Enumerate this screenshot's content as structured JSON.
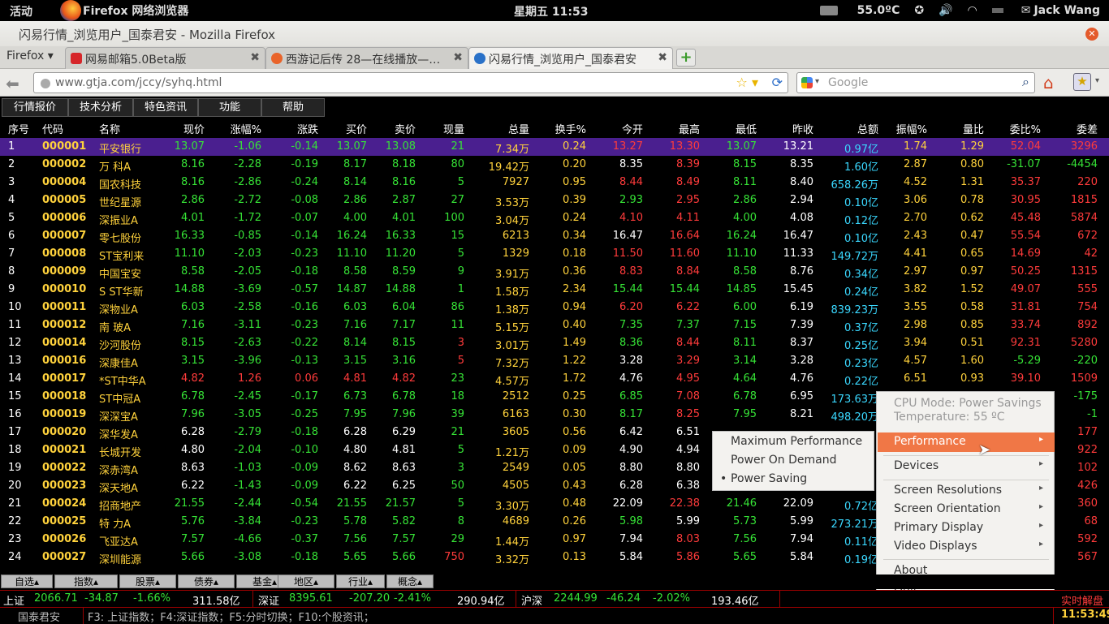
{
  "topbar": {
    "activities": "活动",
    "app": "Firefox 网络浏览器",
    "clock": "星期五 11:53",
    "temp": "55.0ºC",
    "user": "Jack Wang"
  },
  "window": {
    "title": "闪易行情_浏览用户_国泰君安 - Mozilla Firefox"
  },
  "tabs": {
    "menu": "Firefox",
    "items": [
      {
        "label": "网易邮箱5.0Beta版",
        "color": "#d6262a"
      },
      {
        "label": "西游记后传 28—在线播放—…",
        "color": "#e9642a"
      },
      {
        "label": "闪易行情_浏览用户_国泰君安",
        "color": "#2a71c8"
      }
    ]
  },
  "nav": {
    "url": "www.gtja.com/jccy/syhq.html",
    "search_placeholder": "Google"
  },
  "menu": [
    "行情报价",
    "技术分析",
    "特色资讯",
    "功能",
    "帮助"
  ],
  "headers": [
    "序号",
    "代码",
    "名称",
    "现价",
    "涨幅%",
    "涨跌",
    "买价",
    "卖价",
    "现量",
    "总量",
    "换手%",
    "今开",
    "最高",
    "最低",
    "昨收",
    "总额",
    "振幅%",
    "量比",
    "委比%",
    "委差"
  ],
  "rows": [
    [
      "1",
      "000001",
      "平安银行",
      "13.07",
      "-1.06",
      "-0.14",
      "13.07",
      "13.08",
      "21",
      "7.34万",
      "0.24",
      "13.27",
      "13.30",
      "13.07",
      "13.21",
      "0.97亿",
      "1.74",
      "1.29",
      "52.04",
      "3296"
    ],
    [
      "2",
      "000002",
      "万  科A",
      "8.16",
      "-2.28",
      "-0.19",
      "8.17",
      "8.18",
      "80",
      "19.42万",
      "0.20",
      "8.35",
      "8.39",
      "8.15",
      "8.35",
      "1.60亿",
      "2.87",
      "0.80",
      "-31.07",
      "-4454"
    ],
    [
      "3",
      "000004",
      "国农科技",
      "8.16",
      "-2.86",
      "-0.24",
      "8.14",
      "8.16",
      "5",
      "7927",
      "0.95",
      "8.44",
      "8.49",
      "8.11",
      "8.40",
      "658.26万",
      "4.52",
      "1.31",
      "35.37",
      "220"
    ],
    [
      "4",
      "000005",
      "世纪星源",
      "2.86",
      "-2.72",
      "-0.08",
      "2.86",
      "2.87",
      "27",
      "3.53万",
      "0.39",
      "2.93",
      "2.95",
      "2.86",
      "2.94",
      "0.10亿",
      "3.06",
      "0.78",
      "30.95",
      "1815"
    ],
    [
      "5",
      "000006",
      "深振业A",
      "4.01",
      "-1.72",
      "-0.07",
      "4.00",
      "4.01",
      "100",
      "3.04万",
      "0.24",
      "4.10",
      "4.11",
      "4.00",
      "4.08",
      "0.12亿",
      "2.70",
      "0.62",
      "45.48",
      "5874"
    ],
    [
      "6",
      "000007",
      "零七股份",
      "16.33",
      "-0.85",
      "-0.14",
      "16.24",
      "16.33",
      "15",
      "6213",
      "0.34",
      "16.47",
      "16.64",
      "16.24",
      "16.47",
      "0.10亿",
      "2.43",
      "0.47",
      "55.54",
      "672"
    ],
    [
      "7",
      "000008",
      "ST宝利来",
      "11.10",
      "-2.03",
      "-0.23",
      "11.10",
      "11.20",
      "5",
      "1329",
      "0.18",
      "11.50",
      "11.60",
      "11.10",
      "11.33",
      "149.72万",
      "4.41",
      "0.65",
      "14.69",
      "42"
    ],
    [
      "8",
      "000009",
      "中国宝安",
      "8.58",
      "-2.05",
      "-0.18",
      "8.58",
      "8.59",
      "9",
      "3.91万",
      "0.36",
      "8.83",
      "8.84",
      "8.58",
      "8.76",
      "0.34亿",
      "2.97",
      "0.97",
      "50.25",
      "1315"
    ],
    [
      "9",
      "000010",
      "S ST华新",
      "14.88",
      "-3.69",
      "-0.57",
      "14.87",
      "14.88",
      "1",
      "1.58万",
      "2.34",
      "15.44",
      "15.44",
      "14.85",
      "15.45",
      "0.24亿",
      "3.82",
      "1.52",
      "49.07",
      "555"
    ],
    [
      "10",
      "000011",
      "深物业A",
      "6.03",
      "-2.58",
      "-0.16",
      "6.03",
      "6.04",
      "86",
      "1.38万",
      "0.94",
      "6.20",
      "6.22",
      "6.00",
      "6.19",
      "839.23万",
      "3.55",
      "0.58",
      "31.81",
      "754"
    ],
    [
      "11",
      "000012",
      "南  玻A",
      "7.16",
      "-3.11",
      "-0.23",
      "7.16",
      "7.17",
      "11",
      "5.15万",
      "0.40",
      "7.35",
      "7.37",
      "7.15",
      "7.39",
      "0.37亿",
      "2.98",
      "0.85",
      "33.74",
      "892"
    ],
    [
      "12",
      "000014",
      "沙河股份",
      "8.15",
      "-2.63",
      "-0.22",
      "8.14",
      "8.15",
      "3",
      "3.01万",
      "1.49",
      "8.36",
      "8.44",
      "8.11",
      "8.37",
      "0.25亿",
      "3.94",
      "0.51",
      "92.31",
      "5280"
    ],
    [
      "13",
      "000016",
      "深康佳A",
      "3.15",
      "-3.96",
      "-0.13",
      "3.15",
      "3.16",
      "5",
      "7.32万",
      "1.22",
      "3.28",
      "3.29",
      "3.14",
      "3.28",
      "0.23亿",
      "4.57",
      "1.60",
      "-5.29",
      "-220"
    ],
    [
      "14",
      "000017",
      "*ST中华A",
      "4.82",
      "1.26",
      "0.06",
      "4.81",
      "4.82",
      "23",
      "4.57万",
      "1.72",
      "4.76",
      "4.95",
      "4.64",
      "4.76",
      "0.22亿",
      "6.51",
      "0.93",
      "39.10",
      "1509"
    ],
    [
      "15",
      "000018",
      "ST中冠A",
      "6.78",
      "-2.45",
      "-0.17",
      "6.73",
      "6.78",
      "18",
      "2512",
      "0.25",
      "6.85",
      "7.08",
      "6.78",
      "6.95",
      "173.63万",
      "",
      "",
      "",
      "-175"
    ],
    [
      "16",
      "000019",
      "深深宝A",
      "7.96",
      "-3.05",
      "-0.25",
      "7.95",
      "7.96",
      "39",
      "6163",
      "0.30",
      "8.17",
      "8.25",
      "7.95",
      "8.21",
      "498.20万",
      "",
      "",
      "",
      "-1"
    ],
    [
      "17",
      "000020",
      "深华发A",
      "6.28",
      "-2.79",
      "-0.18",
      "6.28",
      "6.29",
      "21",
      "3605",
      "0.56",
      "6.42",
      "6.51",
      "",
      "",
      "",
      "",
      "",
      "",
      "177"
    ],
    [
      "18",
      "000021",
      "长城开发",
      "4.80",
      "-2.04",
      "-0.10",
      "4.80",
      "4.81",
      "5",
      "1.21万",
      "0.09",
      "4.90",
      "4.94",
      "",
      "",
      "",
      "",
      "",
      "",
      "922"
    ],
    [
      "19",
      "000022",
      "深赤湾A",
      "8.63",
      "-1.03",
      "-0.09",
      "8.62",
      "8.63",
      "3",
      "2549",
      "0.05",
      "8.80",
      "8.80",
      "",
      "",
      "",
      "",
      "",
      "",
      "102"
    ],
    [
      "20",
      "000023",
      "深天地A",
      "6.22",
      "-1.43",
      "-0.09",
      "6.22",
      "6.25",
      "50",
      "4505",
      "0.43",
      "6.28",
      "6.38",
      "",
      "",
      "",
      "",
      "",
      "",
      "426"
    ],
    [
      "21",
      "000024",
      "招商地产",
      "21.55",
      "-2.44",
      "-0.54",
      "21.55",
      "21.57",
      "5",
      "3.30万",
      "0.48",
      "22.09",
      "22.38",
      "21.46",
      "22.09",
      "0.72亿",
      "",
      "",
      "",
      "360"
    ],
    [
      "22",
      "000025",
      "特  力A",
      "5.76",
      "-3.84",
      "-0.23",
      "5.78",
      "5.82",
      "8",
      "4689",
      "0.26",
      "5.98",
      "5.99",
      "5.73",
      "5.99",
      "273.21万",
      "",
      "",
      "",
      "68"
    ],
    [
      "23",
      "000026",
      "飞亚达A",
      "7.57",
      "-4.66",
      "-0.37",
      "7.56",
      "7.57",
      "29",
      "1.44万",
      "0.97",
      "7.94",
      "8.03",
      "7.56",
      "7.94",
      "0.11亿",
      "",
      "",
      "",
      "592"
    ],
    [
      "24",
      "000027",
      "深圳能源",
      "5.66",
      "-3.08",
      "-0.18",
      "5.65",
      "5.66",
      "750",
      "3.32万",
      "0.13",
      "5.84",
      "5.86",
      "5.65",
      "5.84",
      "0.19亿",
      "",
      "",
      "",
      "567"
    ]
  ],
  "ctx_left": {
    "items": [
      "Maximum Performance",
      "Power On Demand",
      "Power Saving"
    ],
    "bullet": "•"
  },
  "ctx_right": {
    "cpu": "CPU Mode: Power Savings",
    "temp": "Temperature: 55 ºC",
    "items": [
      "Performance",
      "Devices",
      "Screen Resolutions",
      "Screen Orientation",
      "Primary Display",
      "Video Displays",
      "About",
      "Quit"
    ]
  },
  "btabs": [
    "自选▴",
    "指数▴",
    "股票▴",
    "债券▴",
    "基金▴",
    "地区▴",
    "行业▴",
    "概念▴"
  ],
  "idx": {
    "sh": [
      "上证",
      "2066.71",
      "-34.87",
      "-1.66%",
      "311.58亿"
    ],
    "sz": [
      "深证",
      "8395.61",
      "-207.20",
      "-2.41%",
      "290.94亿"
    ],
    "hs": [
      "沪深",
      "2244.99",
      "-46.24",
      "-2.02%",
      "193.46亿"
    ],
    "rt": "实时解盘"
  },
  "status": {
    "broker": "国泰君安",
    "hint": "F3: 上证指数；F4:深证指数；F5:分时切换；F10:个股资讯；",
    "time": "11:53:49"
  }
}
